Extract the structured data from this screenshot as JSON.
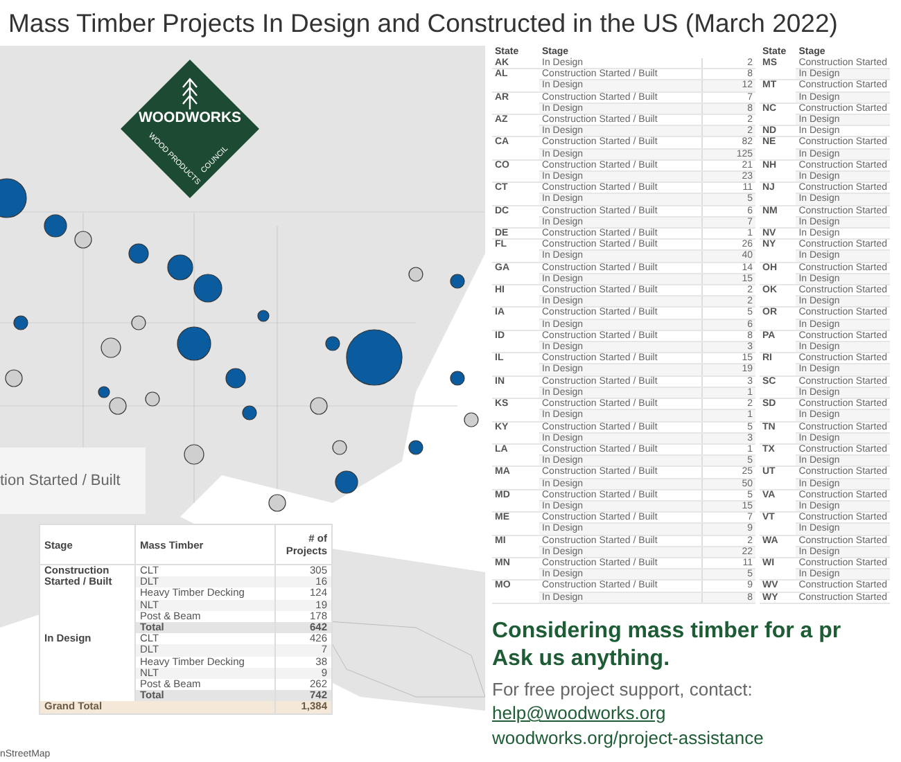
{
  "title": "Mass Timber Projects In Design and Constructed in the US (March 2022)",
  "map": {
    "logo": {
      "name": "WOODWORKS",
      "sub_left": "WOOD PRODUCTS",
      "sub_right": "COUNCIL"
    },
    "legend_text": "tion Started / Built",
    "attribution": "nStreetMap"
  },
  "summary_table": {
    "columns": [
      "Stage",
      "Mass Timber",
      "# of Projects"
    ],
    "groups": [
      {
        "stage": "Construction Started / Built",
        "rows": [
          {
            "type": "CLT",
            "count": "305"
          },
          {
            "type": "DLT",
            "count": "16"
          },
          {
            "type": "Heavy Timber Decking",
            "count": "124"
          },
          {
            "type": "NLT",
            "count": "19"
          },
          {
            "type": "Post & Beam",
            "count": "178"
          }
        ],
        "total": {
          "label": "Total",
          "count": "642"
        }
      },
      {
        "stage": "In Design",
        "rows": [
          {
            "type": "CLT",
            "count": "426"
          },
          {
            "type": "DLT",
            "count": "7"
          },
          {
            "type": "Heavy Timber Decking",
            "count": "38"
          },
          {
            "type": "NLT",
            "count": "9"
          },
          {
            "type": "Post & Beam",
            "count": "262"
          }
        ],
        "total": {
          "label": "Total",
          "count": "742"
        }
      }
    ],
    "grand_total": {
      "label": "Grand Total",
      "count": "1,384"
    }
  },
  "state_tables": [
    {
      "columns": [
        "State",
        "Stage"
      ],
      "groups": [
        {
          "state": "AK",
          "rows": [
            {
              "stage": "In Design",
              "count": "2"
            }
          ]
        },
        {
          "state": "AL",
          "rows": [
            {
              "stage": "Construction Started / Built",
              "count": "8"
            },
            {
              "stage": "In Design",
              "count": "12"
            }
          ]
        },
        {
          "state": "AR",
          "rows": [
            {
              "stage": "Construction Started / Built",
              "count": "7"
            },
            {
              "stage": "In Design",
              "count": "8"
            }
          ]
        },
        {
          "state": "AZ",
          "rows": [
            {
              "stage": "Construction Started / Built",
              "count": "2"
            },
            {
              "stage": "In Design",
              "count": "2"
            }
          ]
        },
        {
          "state": "CA",
          "rows": [
            {
              "stage": "Construction Started / Built",
              "count": "82"
            },
            {
              "stage": "In Design",
              "count": "125"
            }
          ]
        },
        {
          "state": "CO",
          "rows": [
            {
              "stage": "Construction Started / Built",
              "count": "21"
            },
            {
              "stage": "In Design",
              "count": "23"
            }
          ]
        },
        {
          "state": "CT",
          "rows": [
            {
              "stage": "Construction Started / Built",
              "count": "11"
            },
            {
              "stage": "In Design",
              "count": "5"
            }
          ]
        },
        {
          "state": "DC",
          "rows": [
            {
              "stage": "Construction Started / Built",
              "count": "6"
            },
            {
              "stage": "In Design",
              "count": "7"
            }
          ]
        },
        {
          "state": "DE",
          "rows": [
            {
              "stage": "Construction Started / Built",
              "count": "1"
            }
          ]
        },
        {
          "state": "FL",
          "rows": [
            {
              "stage": "Construction Started / Built",
              "count": "26"
            },
            {
              "stage": "In Design",
              "count": "40"
            }
          ]
        },
        {
          "state": "GA",
          "rows": [
            {
              "stage": "Construction Started / Built",
              "count": "14"
            },
            {
              "stage": "In Design",
              "count": "15"
            }
          ]
        },
        {
          "state": "HI",
          "rows": [
            {
              "stage": "Construction Started / Built",
              "count": "2"
            },
            {
              "stage": "In Design",
              "count": "2"
            }
          ]
        },
        {
          "state": "IA",
          "rows": [
            {
              "stage": "Construction Started / Built",
              "count": "5"
            },
            {
              "stage": "In Design",
              "count": "6"
            }
          ]
        },
        {
          "state": "ID",
          "rows": [
            {
              "stage": "Construction Started / Built",
              "count": "8"
            },
            {
              "stage": "In Design",
              "count": "3"
            }
          ]
        },
        {
          "state": "IL",
          "rows": [
            {
              "stage": "Construction Started / Built",
              "count": "15"
            },
            {
              "stage": "In Design",
              "count": "19"
            }
          ]
        },
        {
          "state": "IN",
          "rows": [
            {
              "stage": "Construction Started / Built",
              "count": "3"
            },
            {
              "stage": "In Design",
              "count": "1"
            }
          ]
        },
        {
          "state": "KS",
          "rows": [
            {
              "stage": "Construction Started / Built",
              "count": "2"
            },
            {
              "stage": "In Design",
              "count": "1"
            }
          ]
        },
        {
          "state": "KY",
          "rows": [
            {
              "stage": "Construction Started / Built",
              "count": "5"
            },
            {
              "stage": "In Design",
              "count": "3"
            }
          ]
        },
        {
          "state": "LA",
          "rows": [
            {
              "stage": "Construction Started / Built",
              "count": "1"
            },
            {
              "stage": "In Design",
              "count": "5"
            }
          ]
        },
        {
          "state": "MA",
          "rows": [
            {
              "stage": "Construction Started / Built",
              "count": "25"
            },
            {
              "stage": "In Design",
              "count": "50"
            }
          ]
        },
        {
          "state": "MD",
          "rows": [
            {
              "stage": "Construction Started / Built",
              "count": "5"
            },
            {
              "stage": "In Design",
              "count": "15"
            }
          ]
        },
        {
          "state": "ME",
          "rows": [
            {
              "stage": "Construction Started / Built",
              "count": "7"
            },
            {
              "stage": "In Design",
              "count": "9"
            }
          ]
        },
        {
          "state": "MI",
          "rows": [
            {
              "stage": "Construction Started / Built",
              "count": "2"
            },
            {
              "stage": "In Design",
              "count": "22"
            }
          ]
        },
        {
          "state": "MN",
          "rows": [
            {
              "stage": "Construction Started / Built",
              "count": "11"
            },
            {
              "stage": "In Design",
              "count": "5"
            }
          ]
        },
        {
          "state": "MO",
          "rows": [
            {
              "stage": "Construction Started / Built",
              "count": "9"
            },
            {
              "stage": "In Design",
              "count": "8"
            }
          ]
        }
      ]
    },
    {
      "columns": [
        "State",
        "Stage"
      ],
      "groups": [
        {
          "state": "MS",
          "rows": [
            {
              "stage": "Construction Started"
            },
            {
              "stage": "In Design"
            }
          ]
        },
        {
          "state": "MT",
          "rows": [
            {
              "stage": "Construction Started"
            },
            {
              "stage": "In Design"
            }
          ]
        },
        {
          "state": "NC",
          "rows": [
            {
              "stage": "Construction Started"
            },
            {
              "stage": "In Design"
            }
          ]
        },
        {
          "state": "ND",
          "rows": [
            {
              "stage": "In Design"
            }
          ]
        },
        {
          "state": "NE",
          "rows": [
            {
              "stage": "Construction Started"
            },
            {
              "stage": "In Design"
            }
          ]
        },
        {
          "state": "NH",
          "rows": [
            {
              "stage": "Construction Started"
            },
            {
              "stage": "In Design"
            }
          ]
        },
        {
          "state": "NJ",
          "rows": [
            {
              "stage": "Construction Started"
            },
            {
              "stage": "In Design"
            }
          ]
        },
        {
          "state": "NM",
          "rows": [
            {
              "stage": "Construction Started"
            },
            {
              "stage": "In Design"
            }
          ]
        },
        {
          "state": "NV",
          "rows": [
            {
              "stage": "In Design"
            }
          ]
        },
        {
          "state": "NY",
          "rows": [
            {
              "stage": "Construction Started"
            },
            {
              "stage": "In Design"
            }
          ]
        },
        {
          "state": "OH",
          "rows": [
            {
              "stage": "Construction Started"
            },
            {
              "stage": "In Design"
            }
          ]
        },
        {
          "state": "OK",
          "rows": [
            {
              "stage": "Construction Started"
            },
            {
              "stage": "In Design"
            }
          ]
        },
        {
          "state": "OR",
          "rows": [
            {
              "stage": "Construction Started"
            },
            {
              "stage": "In Design"
            }
          ]
        },
        {
          "state": "PA",
          "rows": [
            {
              "stage": "Construction Started"
            },
            {
              "stage": "In Design"
            }
          ]
        },
        {
          "state": "RI",
          "rows": [
            {
              "stage": "Construction Started"
            },
            {
              "stage": "In Design"
            }
          ]
        },
        {
          "state": "SC",
          "rows": [
            {
              "stage": "Construction Started"
            },
            {
              "stage": "In Design"
            }
          ]
        },
        {
          "state": "SD",
          "rows": [
            {
              "stage": "Construction Started"
            },
            {
              "stage": "In Design"
            }
          ]
        },
        {
          "state": "TN",
          "rows": [
            {
              "stage": "Construction Started"
            },
            {
              "stage": "In Design"
            }
          ]
        },
        {
          "state": "TX",
          "rows": [
            {
              "stage": "Construction Started"
            },
            {
              "stage": "In Design"
            }
          ]
        },
        {
          "state": "UT",
          "rows": [
            {
              "stage": "Construction Started"
            },
            {
              "stage": "In Design"
            }
          ]
        },
        {
          "state": "VA",
          "rows": [
            {
              "stage": "Construction Started"
            },
            {
              "stage": "In Design"
            }
          ]
        },
        {
          "state": "VT",
          "rows": [
            {
              "stage": "Construction Started"
            },
            {
              "stage": "In Design"
            }
          ]
        },
        {
          "state": "WA",
          "rows": [
            {
              "stage": "Construction Started"
            },
            {
              "stage": "In Design"
            }
          ]
        },
        {
          "state": "WI",
          "rows": [
            {
              "stage": "Construction Started"
            },
            {
              "stage": "In Design"
            }
          ]
        },
        {
          "state": "WV",
          "rows": [
            {
              "stage": "Construction Started"
            }
          ]
        },
        {
          "state": "WY",
          "rows": [
            {
              "stage": "Construction Started"
            }
          ]
        }
      ]
    }
  ],
  "contact": {
    "headline": "Considering mass timber for a pr",
    "subhead": "Ask us anything.",
    "text": "For free project support, contact:",
    "email": "help@woodworks.org",
    "link": "woodworks.org/project-assistance"
  }
}
